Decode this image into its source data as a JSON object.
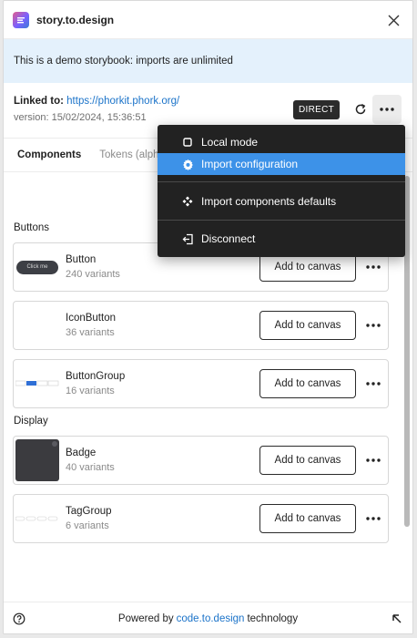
{
  "app": {
    "title": "story.to.design"
  },
  "banner": {
    "text": "This is a demo storybook: imports are unlimited"
  },
  "link": {
    "label": "Linked to:",
    "url": "https://phorkit.phork.org/",
    "version": "version: 15/02/2024, 15:36:51"
  },
  "toolbar": {
    "mode_badge": "DIRECT"
  },
  "tabs": [
    {
      "label": "Components",
      "active": true
    },
    {
      "label": "Tokens (alph",
      "active": false
    }
  ],
  "sections": [
    {
      "title": "Buttons"
    },
    {
      "title": "Display"
    }
  ],
  "components": [
    {
      "name": "Button",
      "variants": "240 variants",
      "thumb_text": "Click me"
    },
    {
      "name": "IconButton",
      "variants": "36 variants"
    },
    {
      "name": "ButtonGroup",
      "variants": "16 variants"
    },
    {
      "name": "Badge",
      "variants": "40 variants"
    },
    {
      "name": "TagGroup",
      "variants": "6 variants"
    }
  ],
  "card_action": {
    "add_label": "Add to canvas"
  },
  "menu": {
    "items": [
      {
        "label": "Local mode",
        "icon": "square-icon",
        "highlighted": false
      },
      {
        "label": "Import configuration",
        "icon": "gear-icon",
        "highlighted": true
      },
      {
        "label": "Import components defaults",
        "icon": "components-icon",
        "highlighted": false
      },
      {
        "label": "Disconnect",
        "icon": "sign-out-icon",
        "highlighted": false
      }
    ]
  },
  "footer": {
    "prefix": "Powered by",
    "link": "code.to.design",
    "suffix": "technology"
  },
  "colors": {
    "accent": "#3d92e8",
    "link": "#1b73c9",
    "banner_bg": "#e4f1fc",
    "menu_bg": "#222222"
  }
}
